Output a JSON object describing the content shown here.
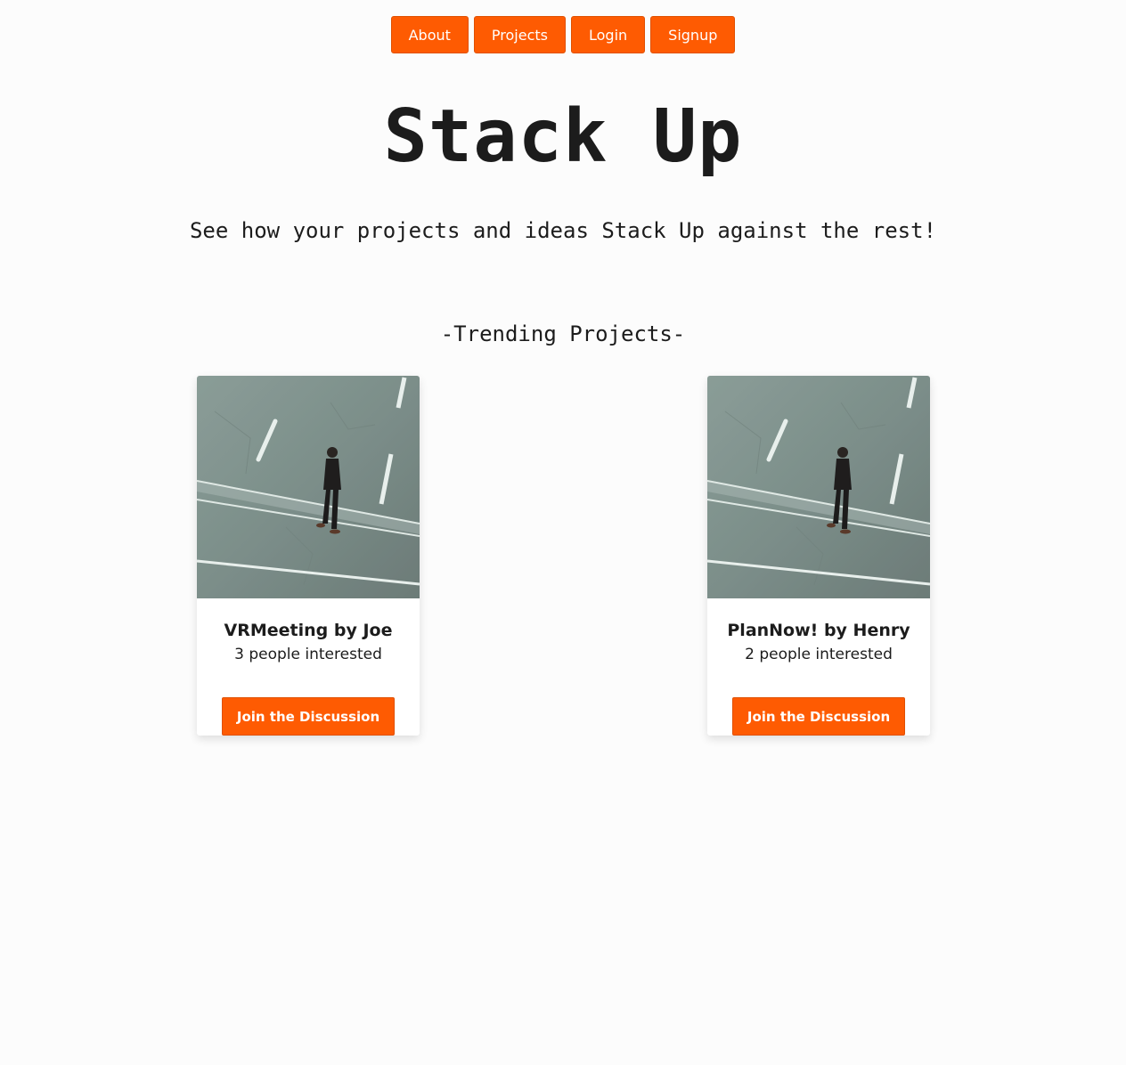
{
  "nav": {
    "items": [
      {
        "label": "About"
      },
      {
        "label": "Projects"
      },
      {
        "label": "Login"
      },
      {
        "label": "Signup"
      }
    ]
  },
  "hero": {
    "title": "Stack Up",
    "subtitle": "See how your projects and ideas Stack Up against the rest!"
  },
  "trending": {
    "heading": "-Trending Projects-",
    "projects": [
      {
        "title": "VRMeeting by Joe",
        "interest": "3 people interested",
        "button_label": "Join the Discussion"
      },
      {
        "title": "PlanNow! by Henry",
        "interest": "2 people interested",
        "button_label": "Join the Discussion"
      }
    ]
  },
  "colors": {
    "accent": "#fe5b02",
    "background": "#fcfcfc",
    "text": "#1c1c1c"
  }
}
